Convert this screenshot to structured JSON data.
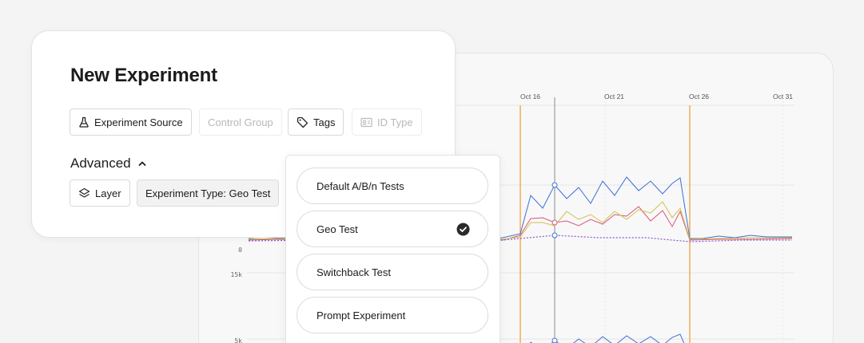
{
  "card": {
    "title": "New Experiment",
    "chips": {
      "experiment_source": "Experiment Source",
      "control_group": "Control Group",
      "tags": "Tags",
      "id_type": "ID Type"
    },
    "advanced_label": "Advanced",
    "advanced_chips": {
      "layer": "Layer",
      "experiment_type": "Experiment Type: Geo Test"
    }
  },
  "dropdown": {
    "options": [
      {
        "label": "Default A/B/n Tests",
        "selected": false
      },
      {
        "label": "Geo Test",
        "selected": true
      },
      {
        "label": "Switchback Test",
        "selected": false
      },
      {
        "label": "Prompt Experiment",
        "selected": false
      }
    ]
  },
  "background_chart": {
    "x_date_labels": [
      "Oct 16",
      "Oct 21",
      "Oct 26",
      "Oct 31"
    ],
    "y_tick_labels": [
      "0",
      "15k",
      "5k"
    ]
  },
  "colors": {
    "blue_series": "#3b6fd8",
    "pink_series": "#e0527e",
    "yellow_series": "#c9c44a",
    "purple_series": "#8a5ad0",
    "event_line": "#f0a040",
    "cursor_line": "#888888"
  }
}
